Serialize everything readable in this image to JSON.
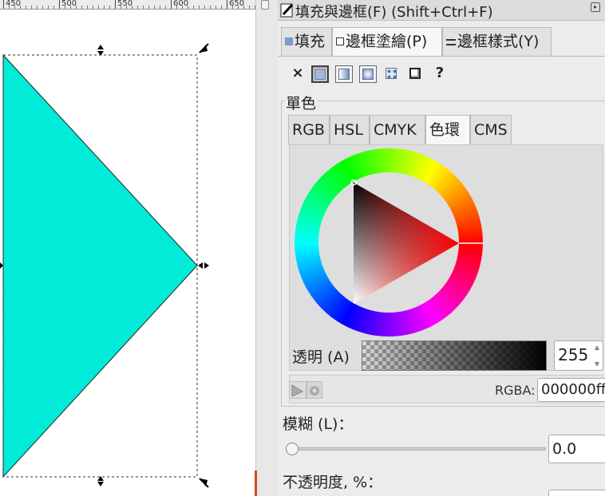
{
  "ruler": {
    "labels": [
      "450",
      "500",
      "550",
      "600",
      "650"
    ]
  },
  "canvas": {
    "fill_color": "#00ecd8",
    "stroke_color": "#222222"
  },
  "panel": {
    "title": "填充與邊框(F) (Shift+Ctrl+F)",
    "tabs": [
      {
        "label": "填充",
        "icon": "fill-icon"
      },
      {
        "label": "邊框塗繪(P)",
        "icon": "stroke-paint-icon",
        "active": true
      },
      {
        "label": "邊框樣式(Y)",
        "icon": "stroke-style-icon"
      }
    ],
    "paint_buttons": [
      {
        "glyph": "×",
        "name": "no-paint-button"
      },
      {
        "glyph": "",
        "name": "flat-color-button",
        "selected": true
      },
      {
        "glyph": "",
        "name": "linear-gradient-button"
      },
      {
        "glyph": "",
        "name": "radial-gradient-button"
      },
      {
        "glyph": "",
        "name": "pattern-button"
      },
      {
        "glyph": "",
        "name": "swatch-button"
      },
      {
        "glyph": "?",
        "name": "unset-paint-button"
      }
    ],
    "section_label": "單色",
    "color_tabs": [
      {
        "label": "RGB"
      },
      {
        "label": "HSL"
      },
      {
        "label": "CMYK"
      },
      {
        "label": "色環",
        "active": true
      },
      {
        "label": "CMS"
      }
    ],
    "alpha": {
      "label": "透明 (A)",
      "value": "255"
    },
    "rgba": {
      "label": "RGBA:",
      "value": "000000ff"
    },
    "blur": {
      "label": "模糊 (L)：",
      "value": "0.0",
      "slider_fraction": 0
    },
    "opacity": {
      "label": "不透明度, %："
    }
  }
}
